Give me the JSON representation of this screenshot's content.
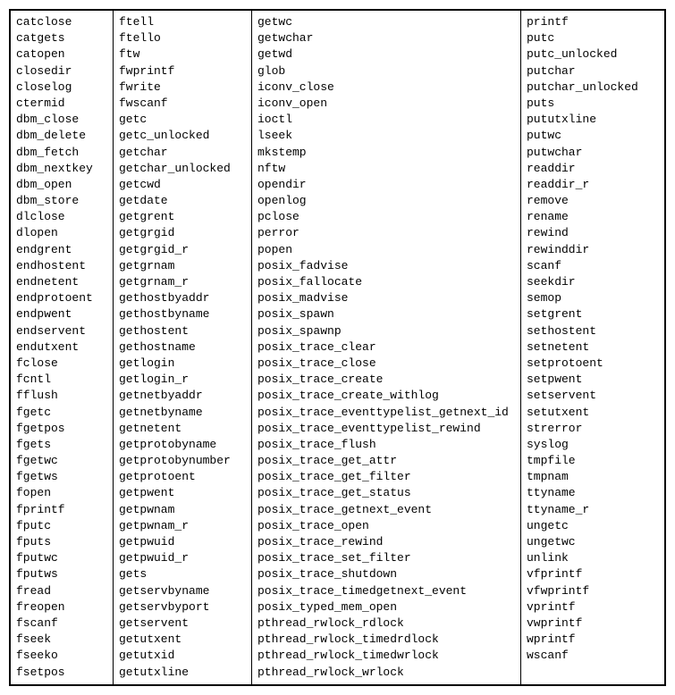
{
  "columns": [
    {
      "items": [
        "catclose",
        "catgets",
        "catopen",
        "closedir",
        "closelog",
        "ctermid",
        "dbm_close",
        "dbm_delete",
        "dbm_fetch",
        "dbm_nextkey",
        "dbm_open",
        "dbm_store",
        "dlclose",
        "dlopen",
        "endgrent",
        "endhostent",
        "endnetent",
        "endprotoent",
        "endpwent",
        "endservent",
        "endutxent",
        "fclose",
        "fcntl",
        "fflush",
        "fgetc",
        "fgetpos",
        "fgets",
        "fgetwc",
        "fgetws",
        "fopen",
        "fprintf",
        "fputc",
        "fputs",
        "fputwc",
        "fputws",
        "fread",
        "freopen",
        "fscanf",
        "fseek",
        "fseeko",
        "fsetpos"
      ]
    },
    {
      "items": [
        "ftell",
        "ftello",
        "ftw",
        "fwprintf",
        "fwrite",
        "fwscanf",
        "getc",
        "getc_unlocked",
        "getchar",
        "getchar_unlocked",
        "getcwd",
        "getdate",
        "getgrent",
        "getgrgid",
        "getgrgid_r",
        "getgrnam",
        "getgrnam_r",
        "gethostbyaddr",
        "gethostbyname",
        "gethostent",
        "gethostname",
        "getlogin",
        "getlogin_r",
        "getnetbyaddr",
        "getnetbyname",
        "getnetent",
        "getprotobyname",
        "getprotobynumber",
        "getprotoent",
        "getpwent",
        "getpwnam",
        "getpwnam_r",
        "getpwuid",
        "getpwuid_r",
        "gets",
        "getservbyname",
        "getservbyport",
        "getservent",
        "getutxent",
        "getutxid",
        "getutxline"
      ]
    },
    {
      "items": [
        "getwc",
        "getwchar",
        "getwd",
        "glob",
        "iconv_close",
        "iconv_open",
        "ioctl",
        "lseek",
        "mkstemp",
        "nftw",
        "opendir",
        "openlog",
        "pclose",
        "perror",
        "popen",
        "posix_fadvise",
        "posix_fallocate",
        "posix_madvise",
        "posix_spawn",
        "posix_spawnp",
        "posix_trace_clear",
        "posix_trace_close",
        "posix_trace_create",
        "posix_trace_create_withlog",
        "posix_trace_eventtypelist_getnext_id",
        "posix_trace_eventtypelist_rewind",
        "posix_trace_flush",
        "posix_trace_get_attr",
        "posix_trace_get_filter",
        "posix_trace_get_status",
        "posix_trace_getnext_event",
        "posix_trace_open",
        "posix_trace_rewind",
        "posix_trace_set_filter",
        "posix_trace_shutdown",
        "posix_trace_timedgetnext_event",
        "posix_typed_mem_open",
        "pthread_rwlock_rdlock",
        "pthread_rwlock_timedrdlock",
        "pthread_rwlock_timedwrlock",
        "pthread_rwlock_wrlock"
      ]
    },
    {
      "items": [
        "printf",
        "putc",
        "putc_unlocked",
        "putchar",
        "putchar_unlocked",
        "puts",
        "pututxline",
        "putwc",
        "putwchar",
        "readdir",
        "readdir_r",
        "remove",
        "rename",
        "rewind",
        "rewinddir",
        "scanf",
        "seekdir",
        "semop",
        "setgrent",
        "sethostent",
        "setnetent",
        "setprotoent",
        "setpwent",
        "setservent",
        "setutxent",
        "strerror",
        "syslog",
        "tmpfile",
        "tmpnam",
        "ttyname",
        "ttyname_r",
        "ungetc",
        "ungetwc",
        "unlink",
        "vfprintf",
        "vfwprintf",
        "vprintf",
        "vwprintf",
        "wprintf",
        "wscanf"
      ]
    }
  ]
}
